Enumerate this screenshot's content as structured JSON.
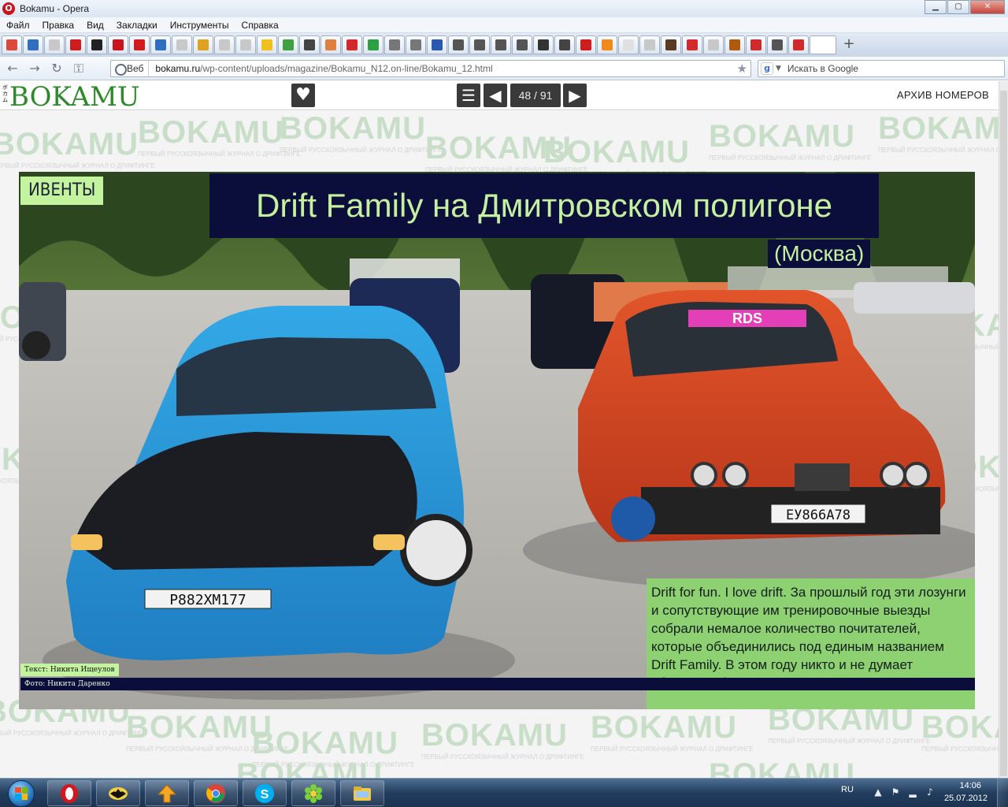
{
  "window": {
    "title": "Bokamu - Opera",
    "minimize_label": "▁",
    "maximize_label": "▢",
    "close_label": "✕"
  },
  "menu": [
    "Файл",
    "Правка",
    "Вид",
    "Закладки",
    "Инструменты",
    "Справка"
  ],
  "tabs": {
    "favicon_colors": [
      "#d94a3a",
      "#2f6fbf",
      "#c8c8c8",
      "#d01c1c",
      "#222222",
      "#c8141c",
      "#d01c1c",
      "#2f6fbf",
      "#c8c8c8",
      "#e0a020",
      "#c8c8c8",
      "#c8c8c8",
      "#f0c020",
      "#3fa040",
      "#444444",
      "#e08040",
      "#d02a2a",
      "#2aa040",
      "#777777",
      "#777777",
      "#2858b0",
      "#555555",
      "#555555",
      "#555555",
      "#555555",
      "#333333",
      "#444444",
      "#d01c1c",
      "#f08a1c",
      "#e0e0e0",
      "#c8c8c8",
      "#5a3a20",
      "#d02a2a",
      "#c8c8c8",
      "#b05a10",
      "#d02a2a",
      "#555555",
      "#d02a2a",
      "#ffffff"
    ],
    "new_tab_label": "+"
  },
  "nav": {
    "back": "←",
    "forward": "→",
    "reload": "↻",
    "key": "⚿",
    "site_badge": "Веб",
    "url_domain": "bokamu.ru",
    "url_path": "/wp-content/uploads/magazine/Bokamu_N12.on-line/Bokamu_12.html",
    "bookmark_star": "★",
    "search_engine_letter": "g",
    "search_placeholder": "Искать в Google"
  },
  "site": {
    "logo_kana": "ボカム",
    "logo": "BOKAMU",
    "favorite_icon": "♥",
    "menu_icon": "☰",
    "prev_icon": "◀",
    "next_icon": "▶",
    "page_current": "48",
    "page_total": "91",
    "page_indicator": "48 / 91",
    "archive_label": "АРХИВ НОМЕРОВ"
  },
  "watermark": {
    "brand": "BOKAMU",
    "tagline": "ПЕРВЫЙ РУССКОЯЗЫЧНЫЙ ЖУРНАЛ О ДРИФТИНГЕ"
  },
  "article": {
    "section": "ИВЕНТЫ",
    "title": "Drift Family на Дмитровском полигоне",
    "city": "(Москва)",
    "lead": "Drift for fun. I love drift. За прошлый год эти лозунги и сопутствующие им тренировочные выезды собрали немалое количество почитателей, которые объединились под единым названием Drift Family. В этом году никто и не думает сбавлять обороты.",
    "credit_text": "Текст: Никита Ищеулов",
    "credit_photo": "Фото: Никита Даренко",
    "plate_blue_car": "Р882ХМ177",
    "plate_orange_car": "ЕУ866А78",
    "windshield_banner": "RDS"
  },
  "taskbar": {
    "apps": [
      "opera",
      "batman",
      "arrow-up",
      "chrome",
      "skype",
      "icq",
      "explorer"
    ],
    "lang": "RU",
    "time": "14:06",
    "date": "25.07.2012"
  }
}
